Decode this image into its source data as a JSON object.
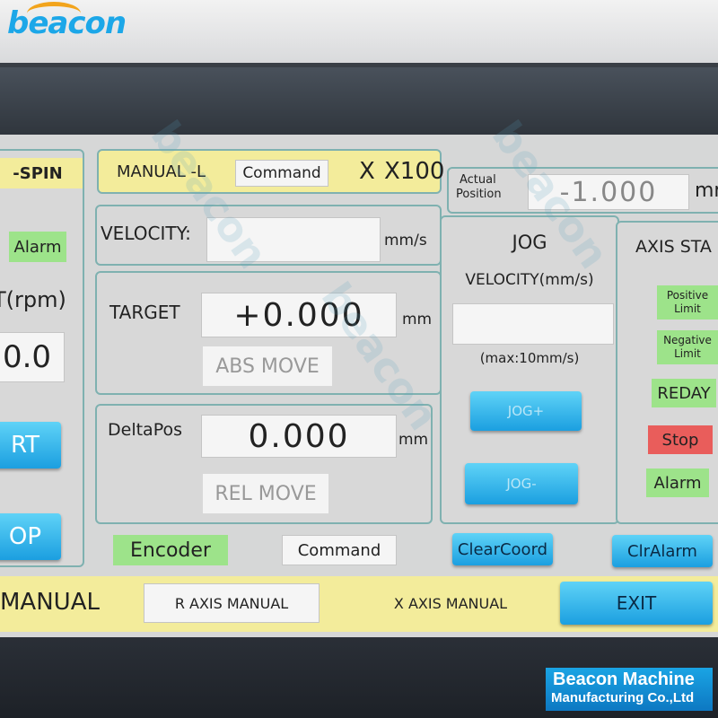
{
  "logo": {
    "text": "beacon"
  },
  "left_panel": {
    "spin_label": "-SPIN",
    "alarm": "Alarm",
    "rpm_label": "T(rpm)",
    "rpm_value": "0.0",
    "start_button": "RT",
    "stop_button": "OP"
  },
  "header": {
    "mode": "MANUAL -L",
    "command": "Command",
    "axis": "X",
    "scale": "X100"
  },
  "actual_position": {
    "label_line1": "Actual",
    "label_line2": "Position",
    "value": "-1.000",
    "unit": "mr"
  },
  "velocity": {
    "label": "VELOCITY:",
    "value": "",
    "unit": "mm/s"
  },
  "target": {
    "label": "TARGET",
    "value": "+0.000",
    "unit": "mm",
    "button": "ABS MOVE"
  },
  "delta": {
    "label": "DeltaPos",
    "value": "0.000",
    "unit": "mm",
    "button": "REL MOVE"
  },
  "jog": {
    "title": "JOG",
    "velocity_label": "VELOCITY(mm/s)",
    "velocity_value": "",
    "max_note": "(max:10mm/s)",
    "plus_button": "JOG+",
    "minus_button": "JOG-"
  },
  "axis_status": {
    "title": "AXIS STA",
    "positive_limit": "Positive Limit",
    "negative_limit": "Negative Limit",
    "ready": "REDAY",
    "stop": "Stop",
    "alarm": "Alarm"
  },
  "footer_row": {
    "encoder": "Encoder",
    "command": "Command",
    "clear_coord": "ClearCoord",
    "clr_alarm": "ClrAlarm"
  },
  "bottom_tabs": {
    "manual": "MANUAL",
    "r_axis": "R AXIS MANUAL",
    "x_axis": "X AXIS MANUAL",
    "exit": "EXIT"
  },
  "brand": {
    "line1": "Beacon Machine",
    "line2": "Manufacturing Co.,Ltd"
  }
}
